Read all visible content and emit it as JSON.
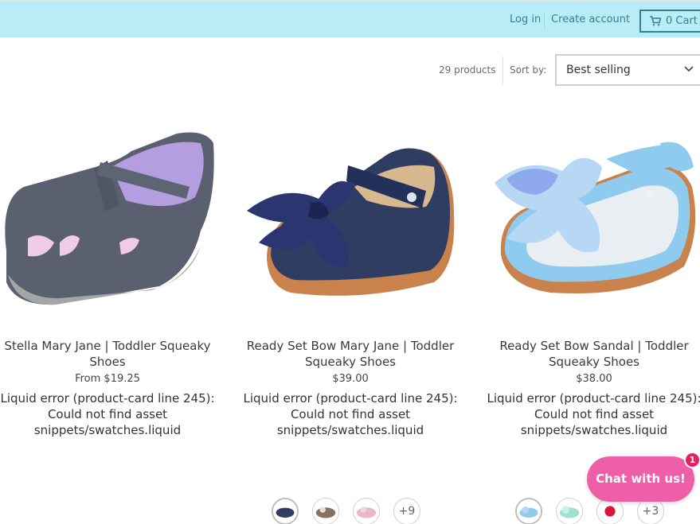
{
  "header": {
    "login": "Log in",
    "create_account": "Create account",
    "cart": "0 Cart"
  },
  "collection": {
    "count": "29 products",
    "sort_label": "Sort by:",
    "sort_value": "Best selling"
  },
  "products": [
    {
      "title": "Stella Mary Jane | Toddler Squeaky Shoes",
      "price": "From $19.25",
      "error": "Liquid error (product-card line 245): Could not find asset snippets/swatches.liquid"
    },
    {
      "title": "Ready Set Bow Mary Jane | Toddler Squeaky Shoes",
      "price": "$39.00",
      "error": "Liquid error (product-card line 245): Could not find asset snippets/swatches.liquid"
    },
    {
      "title": "Ready Set Bow Sandal | Toddler Squeaky Shoes",
      "price": "$38.00",
      "error": "Liquid error (product-card line 245): Could not find asset snippets/swatches.liquid"
    }
  ],
  "swatches": {
    "group1_more": "+9",
    "group2_more": "+3"
  },
  "chat": {
    "label": "Chat with us!",
    "badge": "1"
  },
  "colors": {
    "topbar": "#b8ecf7",
    "link": "#3a7f8d",
    "chat": "#ef5fa7",
    "badge": "#e8205f"
  }
}
